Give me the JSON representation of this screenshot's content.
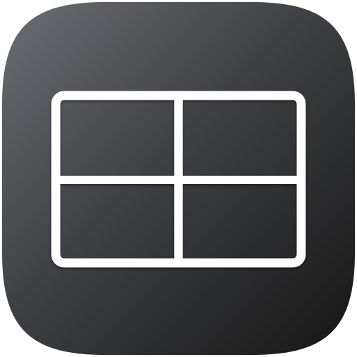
{
  "app_icon": {
    "icon_name": "grid-layout-icon",
    "colors": {
      "background_top_left": "#6b6e73",
      "background_mid": "#3f4043",
      "background_bottom_right": "#161616",
      "glyph": "#ffffff"
    }
  }
}
